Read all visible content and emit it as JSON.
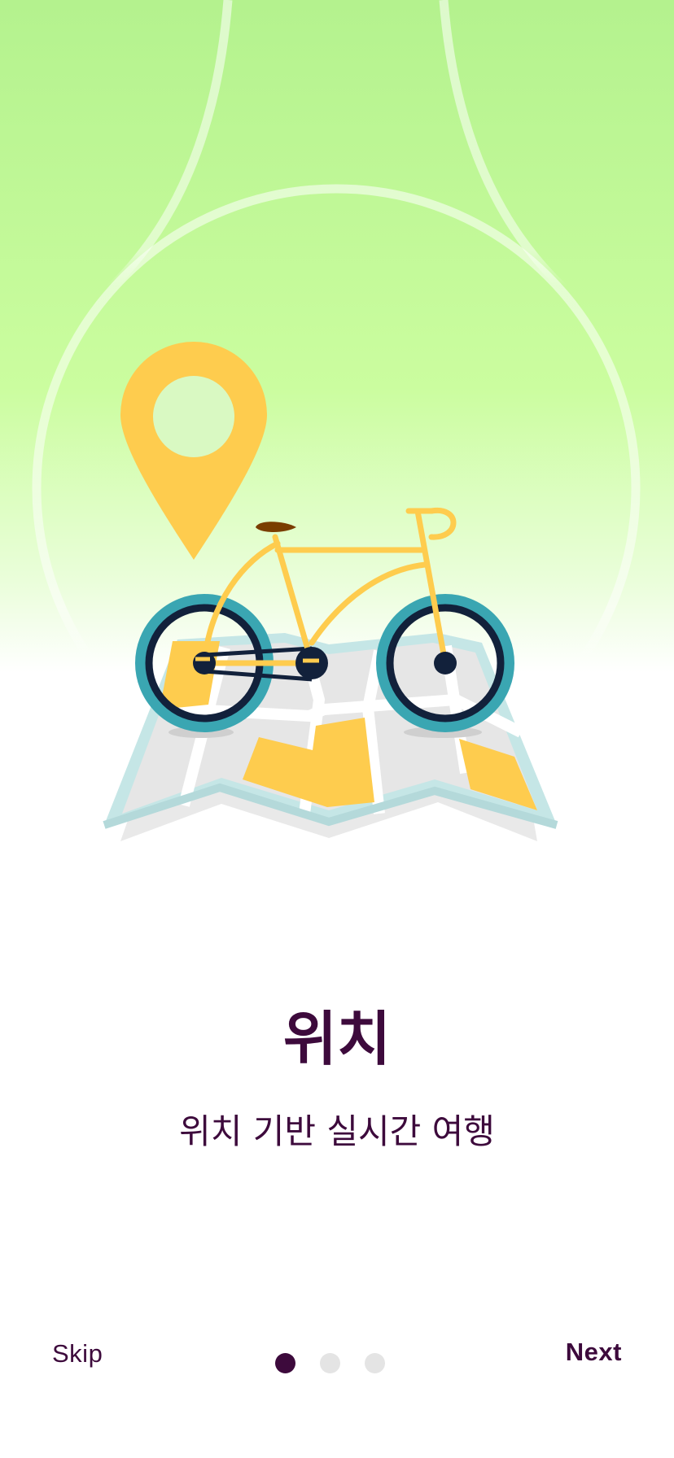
{
  "onboarding": {
    "title": "위치",
    "subtitle": "위치 기반 실시간 여행",
    "skip_label": "Skip",
    "next_label": "Next",
    "page_indicator": {
      "current": 1,
      "total": 3
    }
  },
  "colors": {
    "brand_text": "#3d0a3c",
    "hero_background_top": "#b4f28e",
    "hero_background_bottom": "#ffffff",
    "accent_yellow": "#fecc4e",
    "wheel_teal": "#3aa6b2",
    "wheel_navy": "#12213b",
    "dot_inactive": "#e4e4e4"
  },
  "illustration": {
    "icons": [
      "location-pin-icon",
      "bicycle-icon",
      "folded-map-icon"
    ]
  }
}
